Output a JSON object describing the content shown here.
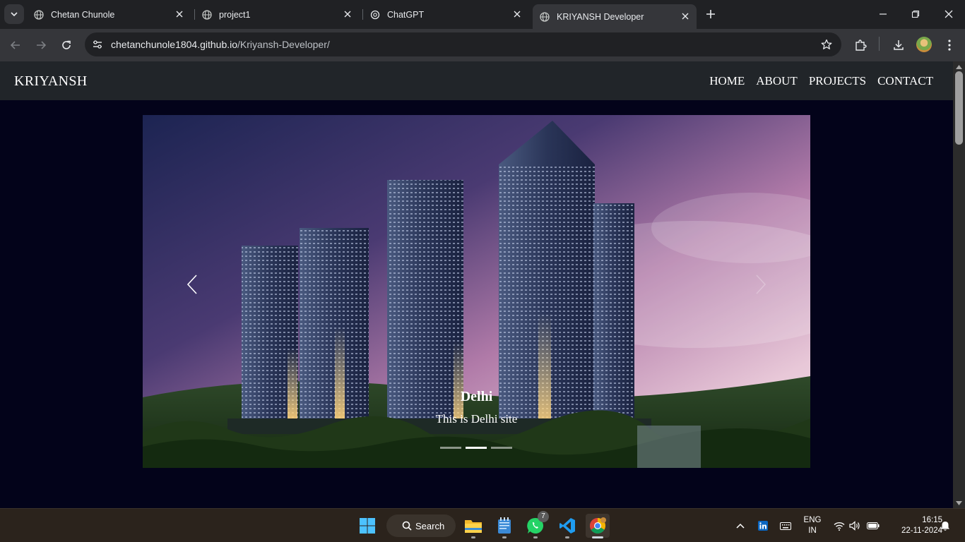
{
  "browser": {
    "tabs": [
      {
        "title": "Chetan Chunole",
        "active": false
      },
      {
        "title": "project1",
        "active": false
      },
      {
        "title": "ChatGPT",
        "active": false
      },
      {
        "title": "KRIYANSH Developer",
        "active": true
      }
    ],
    "url_host": "chetanchunole1804.github.io",
    "url_path": "/Kriyansh-Developer/"
  },
  "site": {
    "brand": "KRIYANSH",
    "nav": [
      "HOME",
      "ABOUT",
      "PROJECTS",
      "CONTACT"
    ]
  },
  "carousel": {
    "slide_title": "Delhi",
    "slide_text": "This is Delhi site",
    "indicator_count": 3,
    "active_indicator": 2
  },
  "taskbar": {
    "search_label": "Search",
    "whatsapp_badge": "7",
    "lang_line1": "ENG",
    "lang_line2": "IN",
    "time": "16:15",
    "date": "22-11-2024"
  }
}
